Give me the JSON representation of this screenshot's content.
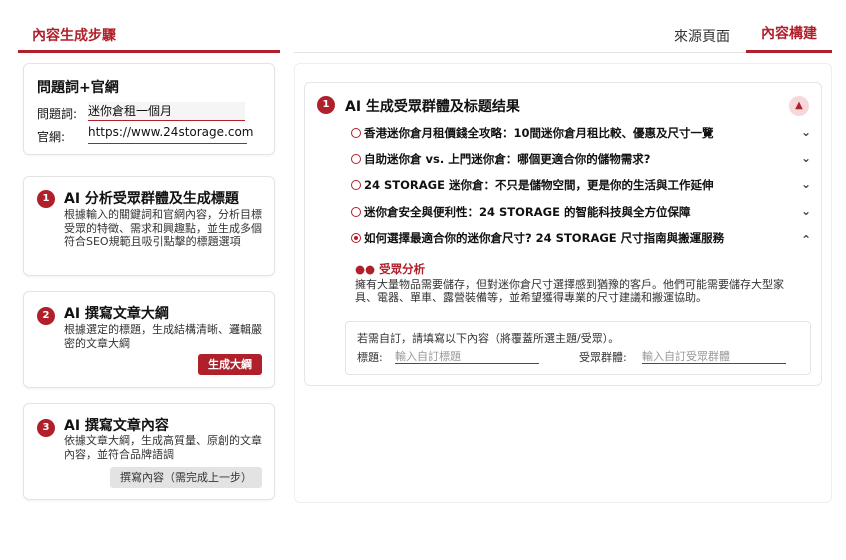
{
  "left": {
    "header": "內容生成步驟",
    "keyword_card": {
      "title": "問題詞+官網",
      "keyword_label": "問題詞:",
      "keyword_value": "迷你倉租一個月",
      "site_label": "官網:",
      "site_value": "https://www.24storage.com"
    },
    "steps": [
      {
        "num": "1",
        "title": "AI 分析受眾群體及生成標題",
        "desc": "根據輸入的關鍵詞和官網內容，分析目標受眾的特徵、需求和興趣點，並生成多個符合SEO規範且吸引點擊的標題選項"
      },
      {
        "num": "2",
        "title": "AI 撰寫文章大綱",
        "desc": "根據選定的標題，生成結構清晰、邏輯嚴密的文章大綱",
        "button": "生成大綱"
      },
      {
        "num": "3",
        "title": "AI 撰寫文章內容",
        "desc": "依據文章大綱，生成高質量、原創的文章內容，並符合品牌語調",
        "button": "撰寫內容（需完成上一步）"
      }
    ]
  },
  "tabs": {
    "source": "來源頁面",
    "build": "內容構建"
  },
  "result": {
    "num": "1",
    "title": "AI 生成受眾群體及标题结果",
    "titles": [
      {
        "text": "香港迷你倉月租價錢全攻略：10間迷你倉月租比較、優惠及尺寸一覽",
        "selected": false
      },
      {
        "text": "自助迷你倉 vs. 上門迷你倉：哪個更適合你的儲物需求?",
        "selected": false
      },
      {
        "text": "24 STORAGE 迷你倉：不只是儲物空間，更是你的生活與工作延伸",
        "selected": false
      },
      {
        "text": "迷你倉安全與便利性：24 STORAGE 的智能科技與全方位保障",
        "selected": false
      },
      {
        "text": "如何選擇最適合你的迷你倉尺寸? 24 STORAGE 尺寸指南與搬運服務",
        "selected": true
      }
    ],
    "audience_heading": "受眾分析",
    "audience_text": "擁有大量物品需要儲存，但對迷你倉尺寸選擇感到猶豫的客戶。他們可能需要儲存大型家具、電器、單車、露營裝備等，並希望獲得專業的尺寸建議和搬運協助。",
    "custom": {
      "note": "若需自訂，請填寫以下內容（將覆蓋所選主題/受眾）。",
      "title_label": "標題:",
      "title_placeholder": "輸入自訂標題",
      "audience_label": "受眾群體:",
      "audience_placeholder": "輸入自訂受眾群體"
    }
  },
  "colors": {
    "accent": "#b0202a"
  }
}
